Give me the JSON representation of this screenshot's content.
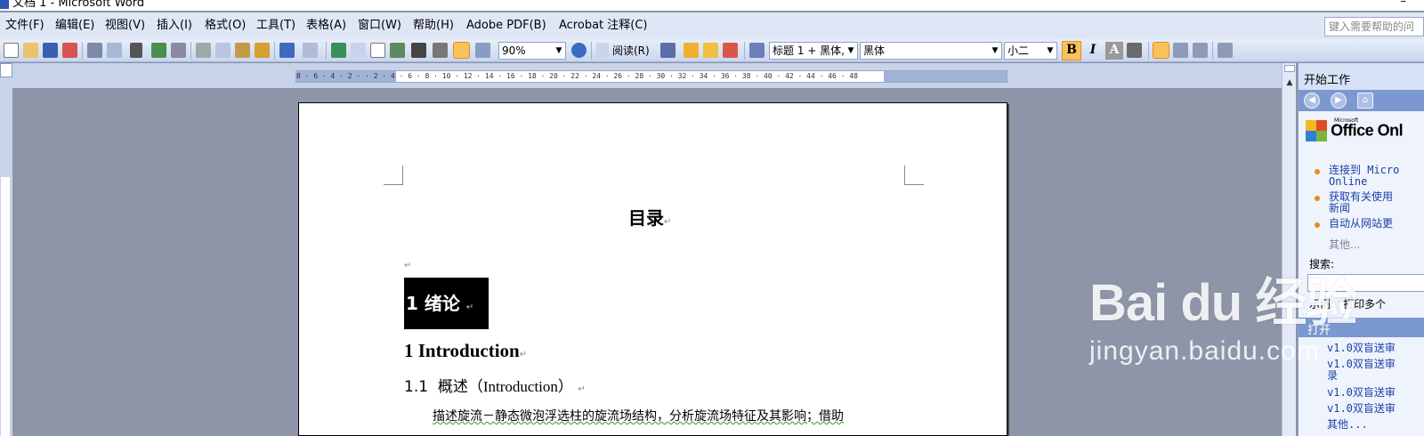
{
  "window": {
    "title": "文档 1 - Microsoft Word"
  },
  "menu": {
    "items": [
      "文件(F)",
      "编辑(E)",
      "视图(V)",
      "插入(I)",
      "格式(O)",
      "工具(T)",
      "表格(A)",
      "窗口(W)",
      "帮助(H)",
      "Adobe PDF(B)",
      "Acrobat 注释(C)"
    ],
    "help_placeholder": "键入需要帮助的问"
  },
  "toolbar": {
    "zoom": "90%",
    "read_label": "阅读(R)",
    "style": "标题 1 + 黑体,",
    "font": "黑体",
    "size": "小二",
    "bold": "B",
    "italic": "I",
    "char_shade": "A"
  },
  "ruler": {
    "text": "8 · 6 · 4 · 2 ·  · 2 · 4 · 6 · 8 · 10 · 12 · 14 · 16 · 18 · 20 · 22 · 24 · 26 · 28 · 30 · 32 · 34 · 36 · 38 · 40 · 42 · 44 · 46 · 48"
  },
  "document": {
    "toc_title": "目录",
    "heading_selected": "1 绪论",
    "heading_en": "1 Introduction",
    "h2_num": "1.1",
    "h2_zh": "概述",
    "h2_en": "（Introduction）",
    "body_line": "描述旋流－静态微泡浮选柱的旋流场结构，分析旋流场特征及其影响；借助",
    "para_mark": "↵"
  },
  "taskpane": {
    "title": "开始工作",
    "office_brand": "Office Onl",
    "ms_small": "Microsoft",
    "links": [
      "连接到 Micro\nOnline",
      "获取有关使用\n新闻",
      "自动从网站更"
    ],
    "more": "其他...",
    "search_label": "搜索:",
    "example": "示例: “打印多个",
    "open_header": "打开",
    "recent": [
      "v1.0双盲送审",
      "v1.0双盲送审\n录",
      "v1.0双盲送审",
      "v1.0双盲送审"
    ],
    "recent_more": "其他..."
  },
  "watermark": {
    "main": "Bai du 经验",
    "sub": "jingyan.baidu.com"
  },
  "colors": {
    "menubar": "#dfe7f6",
    "selection": "#000000",
    "accent": "#f7c35a"
  }
}
